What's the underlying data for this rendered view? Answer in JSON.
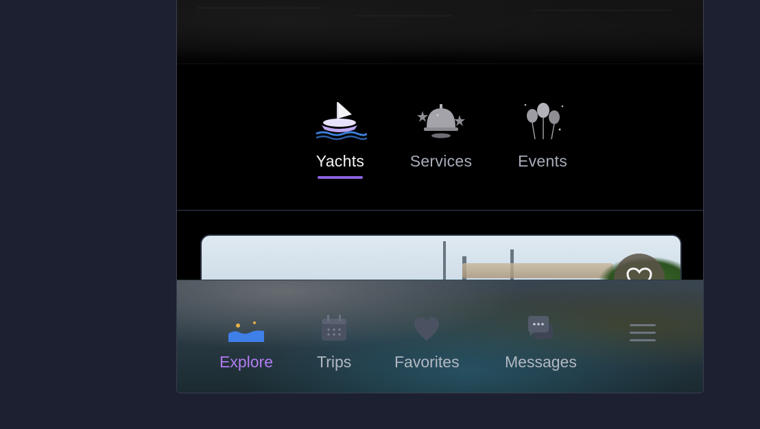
{
  "categories": {
    "items": [
      {
        "label": "Yachts",
        "icon": "sailboat-icon",
        "active": true
      },
      {
        "label": "Services",
        "icon": "concierge-bell-icon",
        "active": false
      },
      {
        "label": "Events",
        "icon": "balloons-icon",
        "active": false
      }
    ]
  },
  "tabbar": {
    "items": [
      {
        "label": "Explore",
        "icon": "explore-waves-icon",
        "active": true
      },
      {
        "label": "Trips",
        "icon": "calendar-icon",
        "active": false
      },
      {
        "label": "Favorites",
        "icon": "heart-icon",
        "active": false
      },
      {
        "label": "Messages",
        "icon": "chat-bubble-icon",
        "active": false
      }
    ],
    "menu_icon": "hamburger-menu-icon"
  },
  "colors": {
    "accent": "#8c63e0",
    "active_tab_label": "#b27cf2",
    "background": "#1d2030"
  }
}
